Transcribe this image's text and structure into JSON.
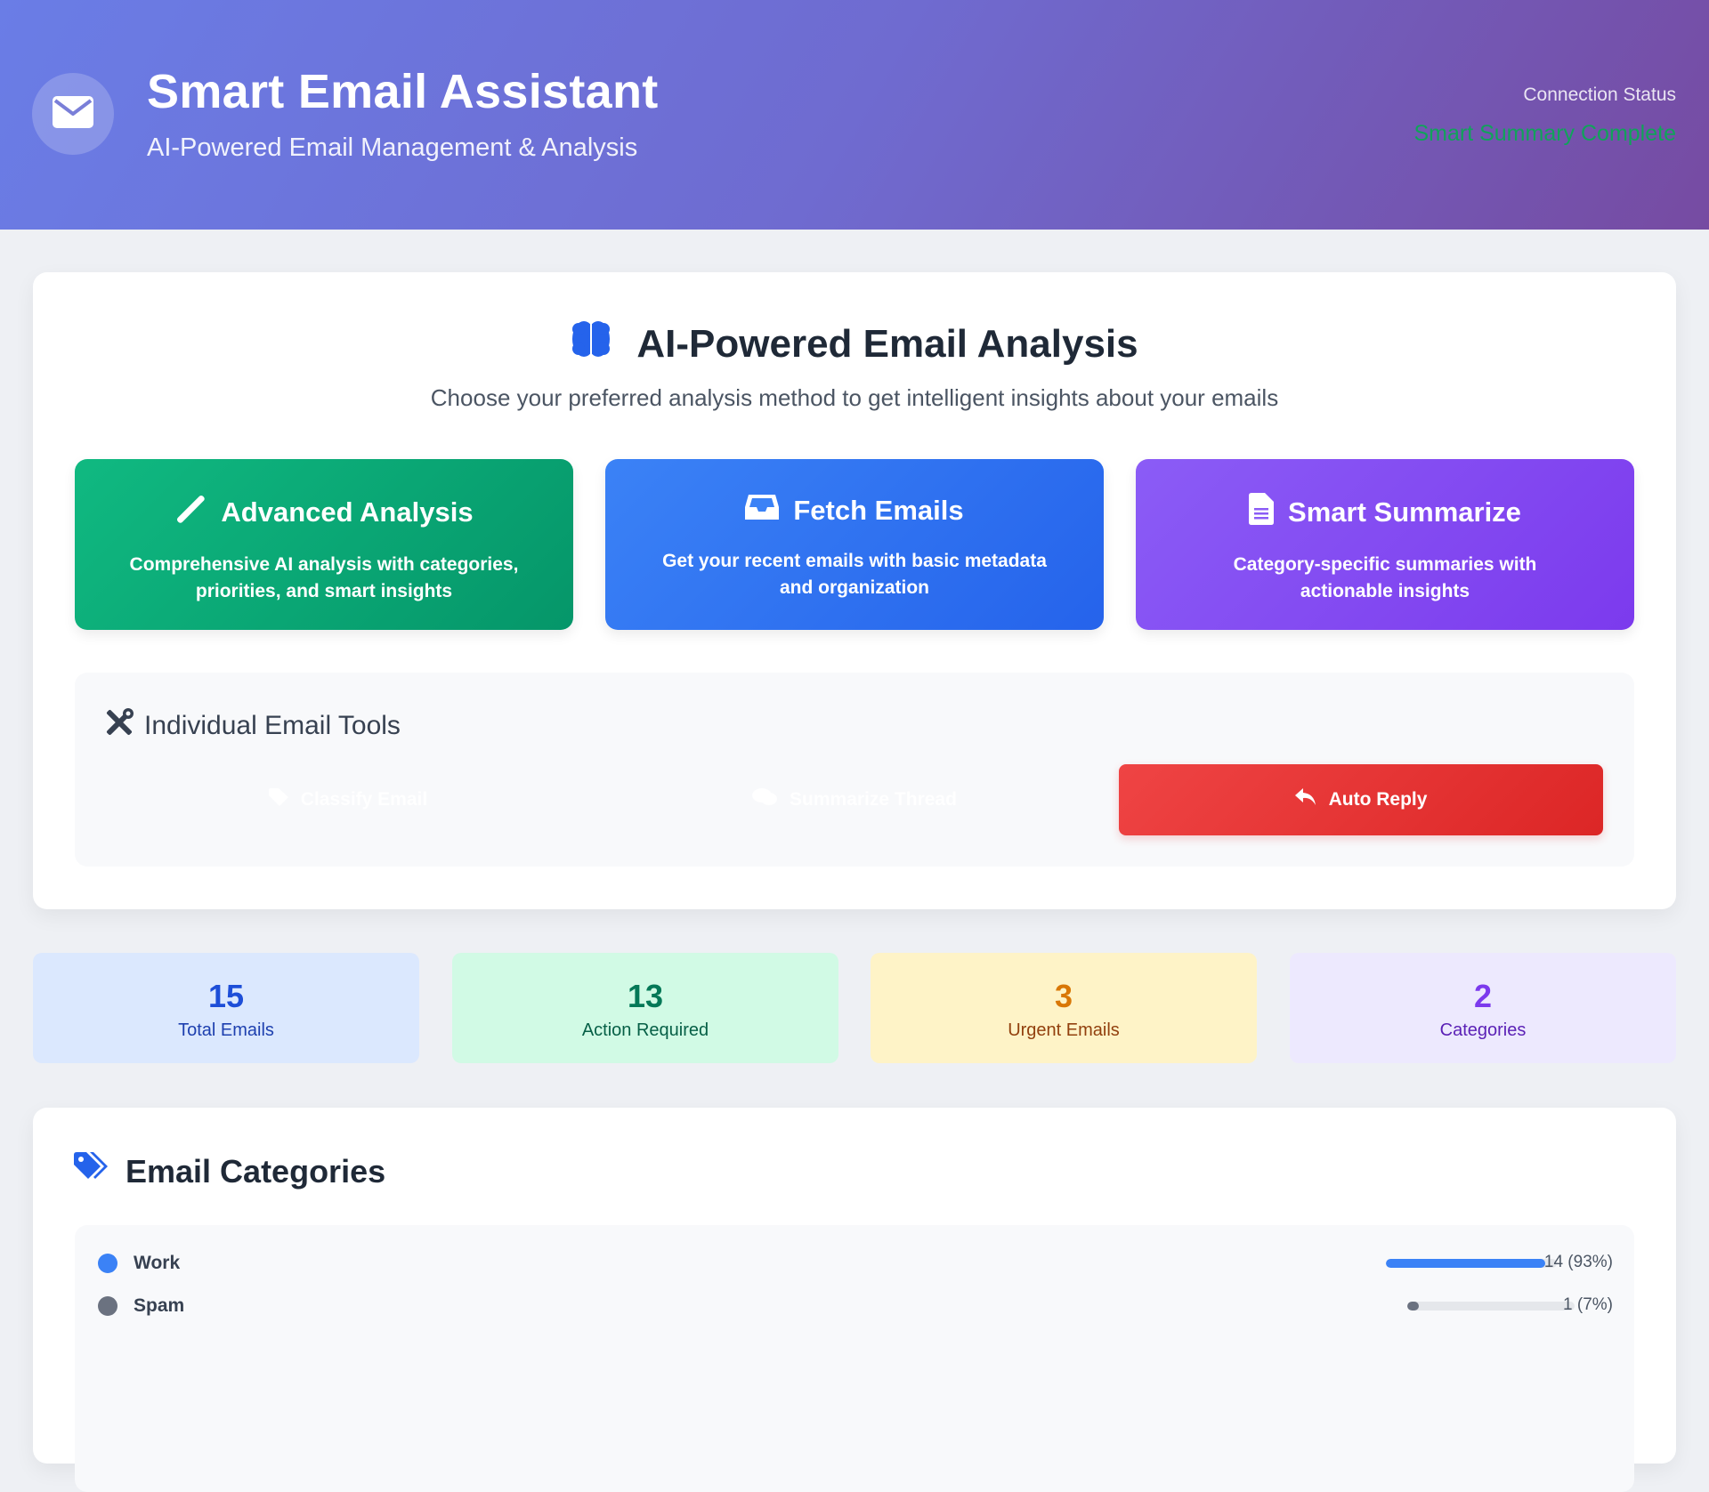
{
  "header": {
    "title": "Smart Email Assistant",
    "subtitle": "AI-Powered Email Management & Analysis",
    "connection_label": "Connection Status",
    "connection_value": "Smart Summary Complete",
    "logo_icon": "envelope-icon"
  },
  "analysis": {
    "title": "AI-Powered Email Analysis",
    "title_icon": "brain-icon",
    "subtitle": "Choose your preferred analysis method to get intelligent insights about your emails",
    "cards": [
      {
        "label": "Advanced Analysis",
        "icon": "wand-icon",
        "desc": "Comprehensive AI analysis with categories, priorities, and smart insights",
        "color": "#10b981"
      },
      {
        "label": "Fetch Emails",
        "icon": "inbox-icon",
        "desc": "Get your recent emails with basic metadata and organization",
        "color": "#3b82f6"
      },
      {
        "label": "Smart Summarize",
        "icon": "document-icon",
        "desc": "Category-specific summaries with actionable insights",
        "color": "#8b5cf6"
      }
    ]
  },
  "tools": {
    "title": "Individual Email Tools",
    "title_icon": "tools-icon",
    "buttons": [
      {
        "label": "Classify Email",
        "icon": "tag-icon"
      },
      {
        "label": "Summarize Thread",
        "icon": "comments-icon"
      },
      {
        "label": "Auto Reply",
        "icon": "reply-icon",
        "color": "#ef4444"
      }
    ]
  },
  "stats": [
    {
      "value": "15",
      "label": "Total Emails"
    },
    {
      "value": "13",
      "label": "Action Required"
    },
    {
      "value": "3",
      "label": "Urgent Emails"
    },
    {
      "value": "2",
      "label": "Categories"
    }
  ],
  "categories": {
    "title": "Email Categories",
    "title_icon": "tags-icon",
    "items": [
      {
        "name": "Work",
        "count_text": "14 (93%)",
        "share": 0.93,
        "color": "#3b82f6"
      },
      {
        "name": "Spam",
        "count_text": "1 (7%)",
        "share": 0.07,
        "color": "#6b7280"
      }
    ]
  }
}
